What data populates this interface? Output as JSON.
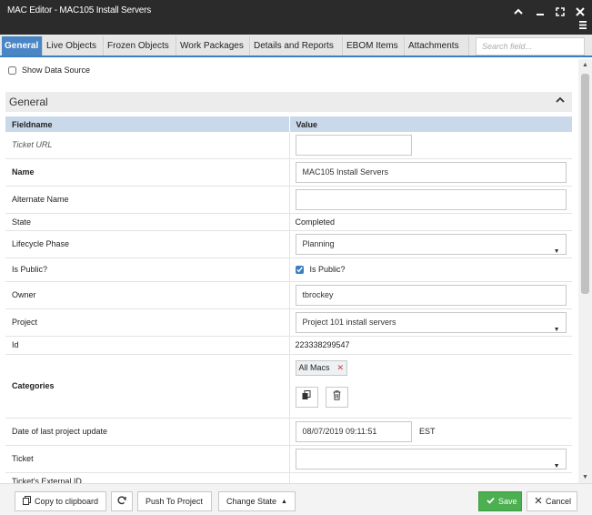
{
  "window": {
    "title": "MAC Editor - MAC105 Install Servers"
  },
  "tabs": [
    {
      "label": "General",
      "active": true
    },
    {
      "label": "Live Objects"
    },
    {
      "label": "Frozen Objects"
    },
    {
      "label": "Work Packages"
    },
    {
      "label": "Details and Reports"
    },
    {
      "label": "EBOM Items"
    },
    {
      "label": "Attachments"
    }
  ],
  "search": {
    "placeholder": "Search field..."
  },
  "show_data_source": {
    "label": "Show Data Source",
    "checked": false
  },
  "section": {
    "title": "General"
  },
  "grid": {
    "headers": {
      "fieldname": "Fieldname",
      "value": "Value"
    },
    "rows": {
      "ticket_url": {
        "label": "Ticket URL",
        "value": ""
      },
      "name": {
        "label": "Name",
        "value": "MAC105 Install Servers"
      },
      "alternate_name": {
        "label": "Alternate Name",
        "value": ""
      },
      "state": {
        "label": "State",
        "value": "Completed"
      },
      "lifecycle_phase": {
        "label": "Lifecycle Phase",
        "value": "Planning"
      },
      "is_public": {
        "label": "Is Public?",
        "checkbox_label": "Is Public?",
        "checked": true
      },
      "owner": {
        "label": "Owner",
        "value": "tbrockey"
      },
      "project": {
        "label": "Project",
        "value": "Project 101 install servers"
      },
      "id": {
        "label": "Id",
        "value": "223338299547"
      },
      "categories": {
        "label": "Categories",
        "chip": "All Macs"
      },
      "date_last_update": {
        "label": "Date of last project update",
        "value": "08/07/2019 09:11:51",
        "tz": "EST"
      },
      "ticket": {
        "label": "Ticket",
        "value": ""
      },
      "ticket_external_id": {
        "label": "Ticket's External ID",
        "value": ""
      }
    }
  },
  "footer": {
    "copy": "Copy to clipboard",
    "push": "Push To Project",
    "change_state": "Change State",
    "save": "Save",
    "cancel": "Cancel"
  },
  "colors": {
    "accent": "#4a86c5",
    "save": "#4caf50",
    "title_bar": "#2b2b2b"
  }
}
